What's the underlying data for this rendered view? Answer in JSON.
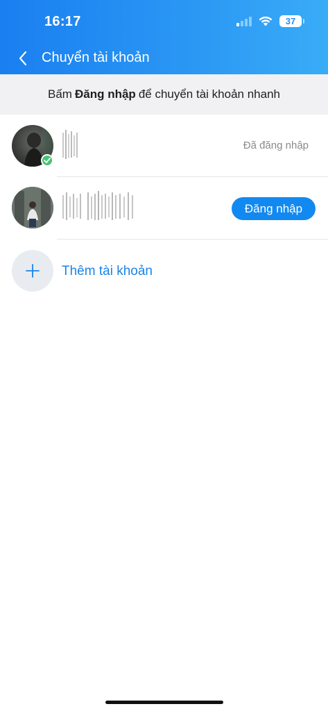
{
  "status_bar": {
    "time": "16:17",
    "battery": "37",
    "icons": [
      "signal-icon",
      "wifi-icon",
      "battery-icon"
    ]
  },
  "header": {
    "title": "Chuyển tài khoản",
    "back_icon": "chevron-left-icon"
  },
  "notice": {
    "prefix": "Bấm",
    "bold": "Đăng nhập",
    "suffix": "để chuyển tài khoản nhanh"
  },
  "accounts": [
    {
      "status": "Đã đăng nhập",
      "active": true
    },
    {
      "action_label": "Đăng nhập",
      "active": false
    }
  ],
  "add_account": {
    "label": "Thêm tài khoản",
    "icon": "plus-icon"
  },
  "colors": {
    "header_start": "#1a7ff0",
    "header_end": "#39acf7",
    "accent": "#1289f0",
    "check": "#46c37a"
  }
}
